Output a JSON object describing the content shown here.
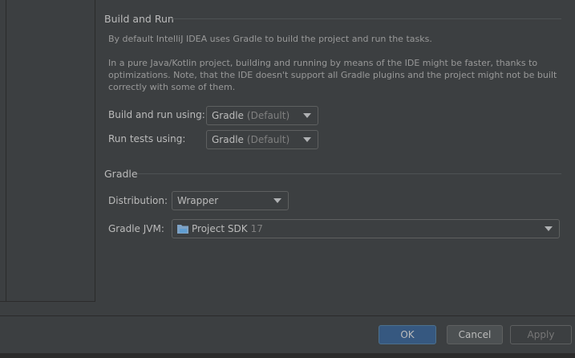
{
  "build_and_run": {
    "title": "Build and Run",
    "desc1": "By default IntelliJ IDEA uses Gradle to build the project and run the tasks.",
    "desc2_line1": "In a pure Java/Kotlin project, building and running by means of the IDE might be faster, thanks to",
    "desc2_line2": "optimizations. Note, that the IDE doesn't support all Gradle plugins and the project might not be built",
    "desc2_line3": "correctly with some of them.",
    "build_label": "Build and run using:",
    "build_value": "Gradle",
    "build_suffix": "(Default)",
    "tests_label": "Run tests using:",
    "tests_value": "Gradle",
    "tests_suffix": "(Default)"
  },
  "gradle": {
    "title": "Gradle",
    "distribution_label": "Distribution:",
    "distribution_value": "Wrapper",
    "jvm_label": "Gradle JVM:",
    "jvm_value": "Project SDK",
    "jvm_version": "17"
  },
  "footer": {
    "ok": "OK",
    "cancel": "Cancel",
    "apply": "Apply"
  }
}
